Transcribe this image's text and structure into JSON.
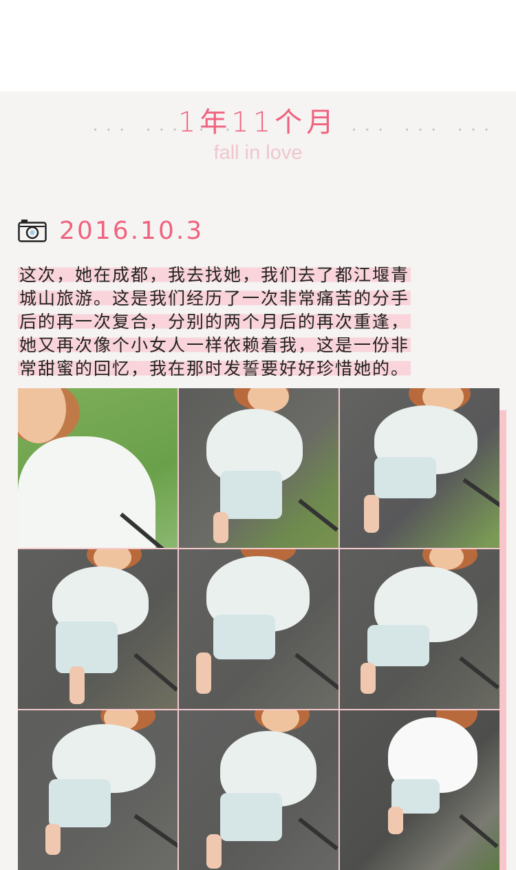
{
  "header": {
    "title": "1年11个月",
    "dots_left": "... ... ...",
    "dots_right": "... ... ...",
    "subtitle": "fall in love"
  },
  "entry": {
    "date": "2016.10.3",
    "lines": [
      "这次，她在成都，我去找她，我们去了都江堰青",
      "城山旅游。这是我们经历了一次非常痛苦的分手",
      "后的再一次复合，分别的两个月后的再次重逢，",
      "她又再次像个小女人一样依赖着我，这是一份非",
      "常甜蜜的回忆，我在那时发誓要好好珍惜她的。"
    ]
  },
  "photos": {
    "count": 9,
    "descriptions_visible": false
  },
  "colors": {
    "accent": "#f0627e",
    "highlight": "#f9d4da",
    "subtitle": "#efc6ce",
    "grid_border": "#f6c9ce"
  },
  "icons": {
    "camera": "camera-icon"
  }
}
